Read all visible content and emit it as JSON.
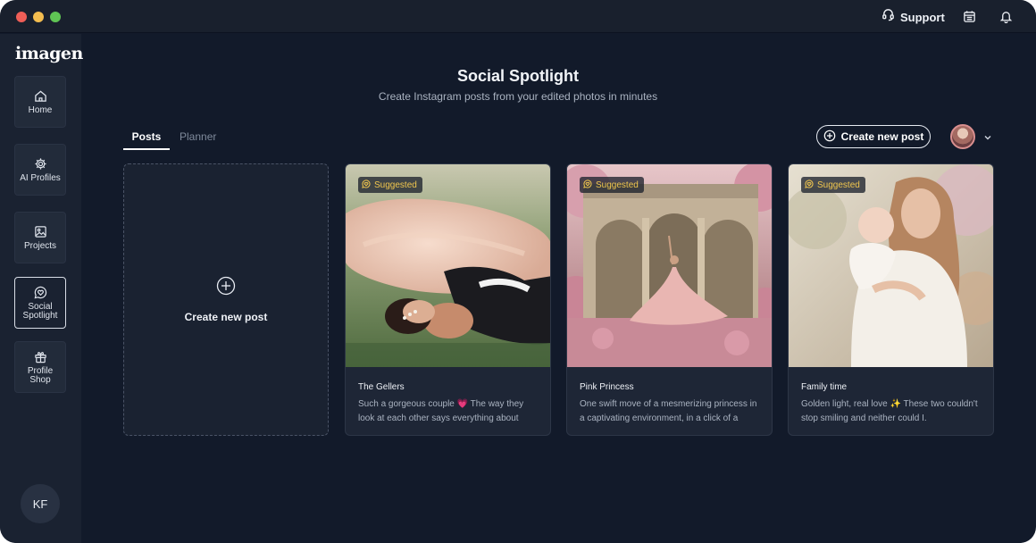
{
  "titlebar": {
    "support_label": "Support"
  },
  "icons": {
    "support": "headset-icon",
    "calendar": "calendar-icon",
    "notifications": "bell-icon"
  },
  "sidebar": {
    "logo": "imagen",
    "items": [
      {
        "label": "Home",
        "icon": "home-icon"
      },
      {
        "label": "AI Profiles",
        "icon": "gear-icon"
      },
      {
        "label": "Projects",
        "icon": "image-icon"
      },
      {
        "label": "Social Spotlight",
        "icon": "heart-chat-icon",
        "active": true
      },
      {
        "label": "Profile Shop",
        "icon": "gift-icon"
      }
    ],
    "user_initials": "KF"
  },
  "main": {
    "title": "Social Spotlight",
    "subtitle": "Create Instagram posts from your edited photos in minutes",
    "tabs": [
      {
        "label": "Posts",
        "active": true
      },
      {
        "label": "Planner",
        "active": false
      }
    ],
    "create_button_label": "Create new post",
    "new_card_label": "Create new post",
    "cards": [
      {
        "badge": "Suggested",
        "title": "The Gellers",
        "text": "Such a gorgeous couple 💗 The way they look at each other says everything about"
      },
      {
        "badge": "Suggested",
        "title": "Pink Princess",
        "text": "One swift move of a mesmerizing princess in a captivating environment, in a click of a"
      },
      {
        "badge": "Suggested",
        "title": "Family time",
        "text": "Golden light, real love ✨ These two couldn't stop smiling and neither could I."
      }
    ]
  },
  "colors": {
    "background": "#121a2a",
    "sidebar": "#1a2231",
    "card": "#1e2636",
    "badge_text": "#f0c64e",
    "accent_border": "#e7ebf2"
  }
}
